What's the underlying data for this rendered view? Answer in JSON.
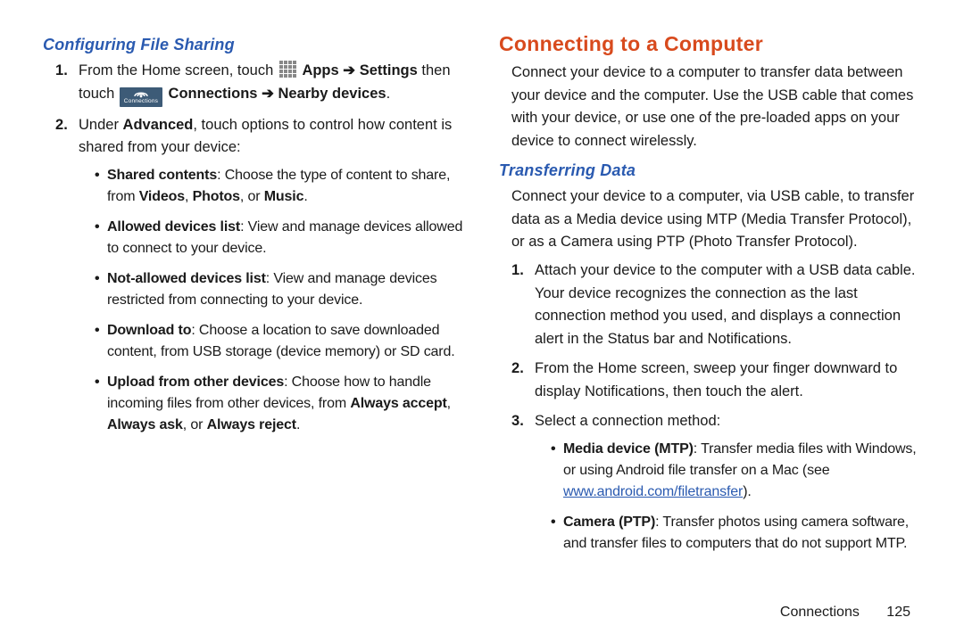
{
  "left": {
    "subhead": "Configuring File Sharing",
    "step1": {
      "pre": "From the Home screen, touch ",
      "apps": "Apps",
      "arrow1": " ➔ ",
      "settings": "Settings",
      "then": " then touch ",
      "connections": "Connections",
      "arrow2": " ➔ ",
      "nearby": "Nearby devices",
      "period": "."
    },
    "step2": {
      "pre": "Under ",
      "advanced": "Advanced",
      "post": ", touch options to control how content is shared from your device:"
    },
    "bullets": {
      "b1": {
        "t": "Shared contents",
        "a": ": Choose the type of content to share, from ",
        "v": "Videos",
        "c1": ", ",
        "p": "Photos",
        "c2": ", or ",
        "m": "Music",
        "end": "."
      },
      "b2": {
        "t": "Allowed devices list",
        "a": ": View and manage devices allowed to connect to your device."
      },
      "b3": {
        "t": "Not-allowed devices list",
        "a": ": View and manage devices restricted from connecting to your device."
      },
      "b4": {
        "t": "Download to",
        "a": ": Choose a location to save downloaded content, from USB storage (device memory) or SD card."
      },
      "b5": {
        "t": "Upload from other devices",
        "a": ": Choose how to handle incoming files from other devices, from ",
        "o1": "Always accept",
        "c1": ", ",
        "o2": "Always ask",
        "c2": ", or ",
        "o3": "Always reject",
        "end": "."
      }
    }
  },
  "right": {
    "sectionHead": "Connecting to a Computer",
    "intro": "Connect your device to a computer to transfer data between your device and the computer. Use the USB cable that comes with your device, or use one of the pre-loaded apps on your device to connect wirelessly.",
    "subhead": "Transferring Data",
    "para": "Connect your device to a computer, via USB cable, to transfer data as a Media device using MTP (Media Transfer Protocol), or as a Camera using PTP (Photo Transfer Protocol).",
    "step1": "Attach your device to the computer with a USB data cable. Your device recognizes the connection as the last connection method you used, and displays a connection alert in the Status bar and Notifications.",
    "step2": "From the Home screen, sweep your finger downward to display Notifications, then touch the alert.",
    "step3": "Select a connection method:",
    "bullets": {
      "b1": {
        "t": "Media device (MTP)",
        "a": ": Transfer media files with Windows, or using Android file transfer on a Mac (see ",
        "link": "www.android.com/filetransfer",
        "end": ")."
      },
      "b2": {
        "t": "Camera (PTP)",
        "a": ": Transfer photos using camera software, and transfer files to computers that do not support MTP."
      }
    }
  },
  "footer": {
    "chapter": "Connections",
    "page": "125"
  },
  "iconConnLabel": "Connections"
}
